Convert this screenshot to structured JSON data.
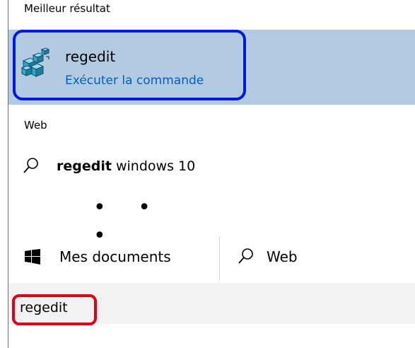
{
  "best_match": {
    "section_label": "Meilleur résultat",
    "app_name": "regedit",
    "app_subtitle": "Exécuter la commande",
    "icon": "registry-editor-icon"
  },
  "web_section": {
    "section_label": "Web",
    "result_bold": "regedit",
    "result_rest": " windows 10",
    "icon": "search-icon"
  },
  "more_indicator": "• • •",
  "filters": {
    "documents_label": "Mes documents",
    "documents_icon": "windows-logo-icon",
    "web_label": "Web",
    "web_icon": "search-icon"
  },
  "search_box": {
    "value": "regedit"
  },
  "colors": {
    "selected_row": "#b2cbe2",
    "blue_highlight": "#0018e6",
    "red_highlight": "#e0001a",
    "link_blue": "#0060b8"
  }
}
